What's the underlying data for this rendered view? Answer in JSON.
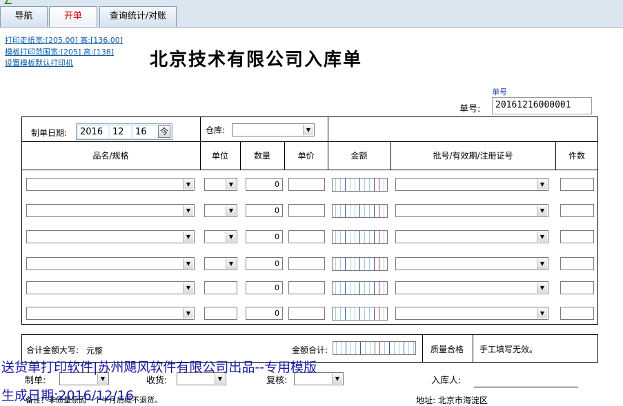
{
  "tabs": [
    {
      "label": "导航"
    },
    {
      "label": "开单"
    },
    {
      "label": "查询统计/对账"
    }
  ],
  "print_links": {
    "paper_size": "打印走纸宽:[205.00] 高:[136.00]",
    "template_range": "模板打印范围宽:[205] 高:[138]",
    "default_printer": "设置模板默认打印机"
  },
  "form": {
    "title": "北京技术有限公司入库单",
    "order_no_caption": "单号",
    "order_no_label": "单号:",
    "order_no_value": "20161216000001",
    "date_label": "制单日期:",
    "date_year": "2016",
    "date_month": "12",
    "date_day": "16",
    "today_button": "今",
    "warehouse_label": "仓库:"
  },
  "columns": {
    "name": "品名/规格",
    "unit": "单位",
    "qty": "数量",
    "price": "单价",
    "amount": "金额",
    "batch": "批号/有效期/注册证号",
    "pieces": "件数"
  },
  "rows": [
    {
      "qty": "0"
    },
    {
      "qty": "0"
    },
    {
      "qty": "0"
    },
    {
      "qty": "0"
    },
    {
      "qty": "0"
    },
    {
      "qty": "0"
    }
  ],
  "summary": {
    "amount_words_label": "合计金额大写:",
    "amount_words_value": "元整",
    "amount_total_label": "金额合计:",
    "quality_label": "质量合格",
    "handwrite_note": "手工填写无效。"
  },
  "footer": {
    "maker_label": "制单:",
    "receiver_label": "收货:",
    "reviewer_label": "复核:",
    "stocker_label": "入库人:",
    "remark": "备注：非质量原因一个半月后概不退货。",
    "address": "地址: 北京市海淀区"
  },
  "watermark": {
    "line1": "送货单打印软件|苏州飓风软件有限公司出品--专用模版",
    "line2": "生成日期:2016/12/16"
  }
}
